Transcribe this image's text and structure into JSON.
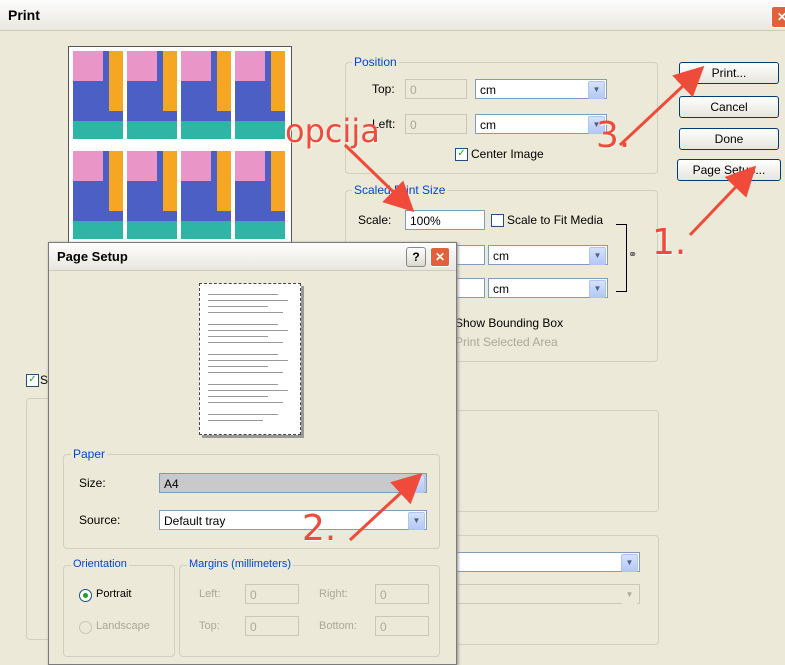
{
  "print": {
    "title": "Print",
    "close_glyph": "✕",
    "position_group": "Position",
    "top_label": "Top:",
    "top_value": "0",
    "left_label": "Left:",
    "left_value": "0",
    "unit_cm": "cm",
    "center_image": "Center Image",
    "scaled_group": "Scaled Print Size",
    "scale_label": "Scale:",
    "scale_value": "100%",
    "scale_to_fit": "Scale to Fit Media",
    "show_bounding": "Show Bounding Box",
    "print_selected": "Print Selected Area",
    "left_check_label": "Sl",
    "btn_print": "Print...",
    "btn_cancel": "Cancel",
    "btn_done": "Done",
    "btn_page_setup": "Page Setup..."
  },
  "page_setup": {
    "title": "Page Setup",
    "help_glyph": "?",
    "close_glyph": "✕",
    "paper_group": "Paper",
    "size_label": "Size:",
    "size_value": "A4",
    "source_label": "Source:",
    "source_value": "Default tray",
    "orientation_group": "Orientation",
    "portrait": "Portrait",
    "landscape": "Landscape",
    "margins_group": "Margins (millimeters)",
    "left_label": "Left:",
    "left_value": "0",
    "right_label": "Right:",
    "right_value": "0",
    "top_label": "Top:",
    "top_value": "0",
    "bottom_label": "Bottom:",
    "bottom_value": "0"
  },
  "annotations": {
    "opcija": "opcija",
    "step1": "1.",
    "step2": "2.",
    "step3": "3."
  },
  "colors": {
    "annotation": "#f04a3a",
    "group_label": "#0046d5"
  },
  "icons": {
    "dropdown": "chevron-down-icon",
    "close": "close-icon",
    "help": "help-icon",
    "link": "chain-link-icon"
  }
}
